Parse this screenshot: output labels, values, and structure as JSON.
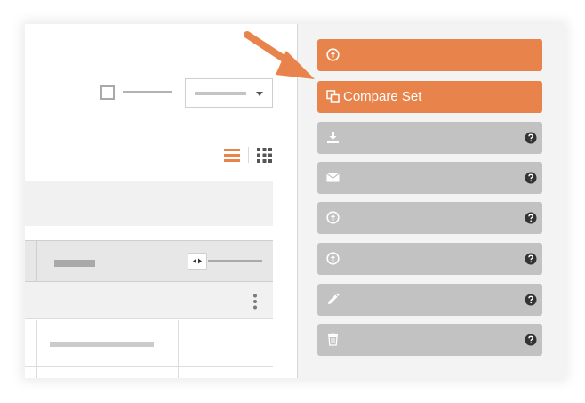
{
  "colors": {
    "accent": "#e8844b",
    "disabled": "#c2c2c2",
    "help_icon": "#333333"
  },
  "toolbar": {
    "checkbox_icon": "checkbox-icon",
    "dropdown_icon": "caret-down-icon",
    "view_icons": [
      "list-view-icon",
      "grid-view-icon"
    ]
  },
  "actions": [
    {
      "label": "",
      "icon": "upload-circle-icon",
      "style": "orange",
      "help": false
    },
    {
      "label": "Compare Set",
      "icon": "compare-icon",
      "style": "orange",
      "help": false
    },
    {
      "label": "",
      "icon": "download-icon",
      "style": "disabled",
      "help": true
    },
    {
      "label": "",
      "icon": "envelope-icon",
      "style": "disabled",
      "help": true
    },
    {
      "label": "",
      "icon": "upload-circle-icon",
      "style": "disabled",
      "help": true
    },
    {
      "label": "",
      "icon": "upload-circle-icon",
      "style": "disabled",
      "help": true
    },
    {
      "label": "",
      "icon": "pencil-icon",
      "style": "disabled",
      "help": true
    },
    {
      "label": "",
      "icon": "trash-icon",
      "style": "disabled",
      "help": true
    }
  ],
  "annotation": {
    "icon": "callout-arrow-icon",
    "color": "#e8844b"
  }
}
